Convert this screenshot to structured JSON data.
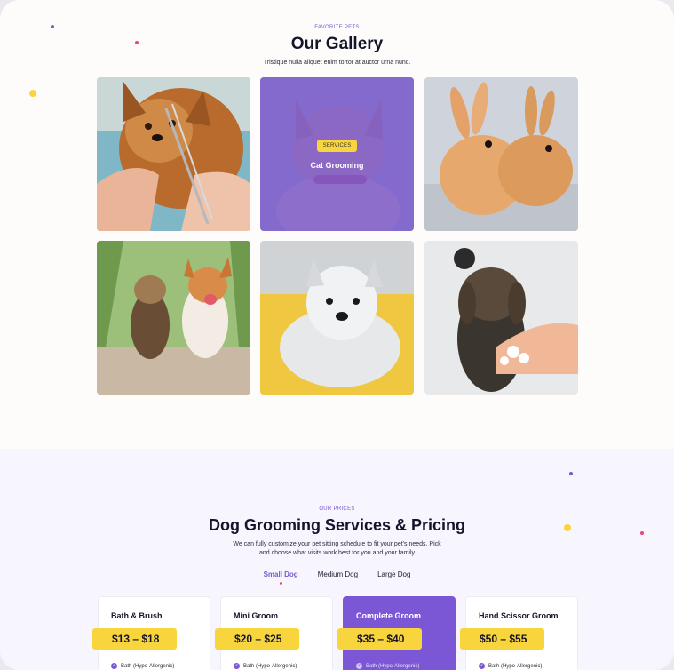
{
  "gallery": {
    "eyebrow": "FAVORITE PETS",
    "title": "Our Gallery",
    "subtitle": "Tristique nulla aliquet enim tortor at auctor urna nunc.",
    "tiles": [
      {
        "name": "yorkie-grooming",
        "label": ""
      },
      {
        "name": "cat-grooming",
        "badge": "SERVICES",
        "label": "Cat Grooming"
      },
      {
        "name": "bunnies",
        "label": ""
      },
      {
        "name": "dogs-running",
        "label": ""
      },
      {
        "name": "white-terrier",
        "label": ""
      },
      {
        "name": "dog-bath",
        "label": ""
      }
    ]
  },
  "pricing": {
    "eyebrow": "OUR PRICES",
    "title": "Dog Grooming Services & Pricing",
    "subtitle_line1": "We can fully customize your pet sitting schedule to fit your pet's needs. Pick",
    "subtitle_line2": "and choose what visits work best for you and your family",
    "tabs": [
      "Small Dog",
      "Medium Dog",
      "Large Dog"
    ],
    "active_tab": "Small Dog",
    "cards": [
      {
        "title": "Bath & Brush",
        "price": "$13 – $18",
        "feature": "Bath (Hypo-Allergenic)",
        "featured": false
      },
      {
        "title": "Mini Groom",
        "price": "$20 – $25",
        "feature": "Bath (Hypo-Allergenic)",
        "featured": false
      },
      {
        "title": "Complete Groom",
        "price": "$35 – $40",
        "feature": "Bath (Hypo-Allergenic)",
        "featured": true
      },
      {
        "title": "Hand Scissor Groom",
        "price": "$50 – $55",
        "feature": "Bath (Hypo-Allergenic)",
        "featured": false
      }
    ]
  },
  "colors": {
    "accent": "#7b57d6",
    "highlight": "#f9d53d",
    "pink": "#f0437b",
    "heading": "#14142b"
  }
}
